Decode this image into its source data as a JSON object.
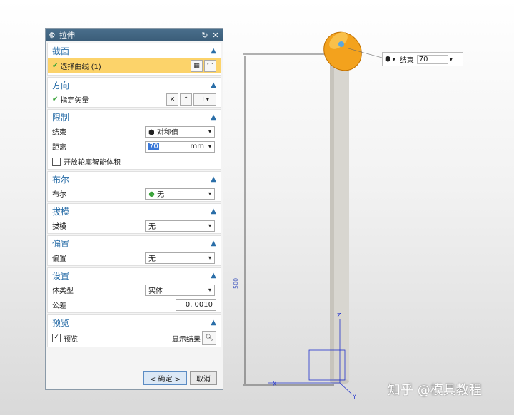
{
  "dialog": {
    "title": "拉伸",
    "section_profile": {
      "title": "截面",
      "select_label": "选择曲线 (1)"
    },
    "section_direction": {
      "title": "方向",
      "vector_label": "指定矢量"
    },
    "section_limits": {
      "title": "限制",
      "end_label": "结束",
      "end_value": "对称值",
      "distance_label": "距离",
      "distance_value": "70",
      "distance_unit": "mm",
      "open_profile_label": "开放轮廓智能体积"
    },
    "section_boolean": {
      "title": "布尔",
      "label": "布尔",
      "value": "无"
    },
    "section_draft": {
      "title": "拔模",
      "label": "拔模",
      "value": "无"
    },
    "section_offset": {
      "title": "偏置",
      "label": "偏置",
      "value": "无"
    },
    "section_settings": {
      "title": "设置",
      "body_type_label": "体类型",
      "body_type_value": "实体",
      "tolerance_label": "公差",
      "tolerance_value": "0. 0010"
    },
    "section_preview": {
      "title": "预览",
      "preview_label": "预览",
      "show_result_label": "显示结果"
    },
    "ok_label": "< 确定 >",
    "cancel_label": "取消"
  },
  "float_toolbar": {
    "end_label": "结束",
    "value": "70"
  },
  "viewport": {
    "dimension_label": "500",
    "axis_x": "X",
    "axis_y": "Y",
    "axis_z": "Z"
  },
  "watermark": "知乎 @模具教程",
  "colors": {
    "selection": "#fcd36a",
    "accent": "#2a6ea8",
    "model": "#f3a21d"
  }
}
